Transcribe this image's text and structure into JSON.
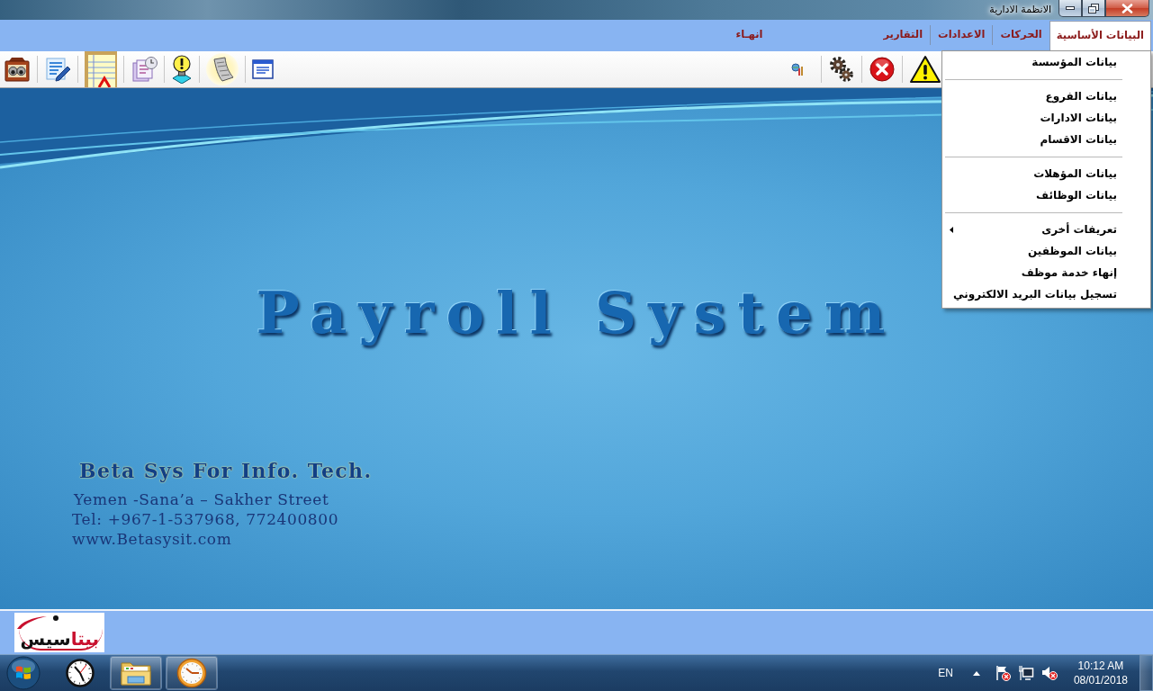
{
  "window": {
    "title": "الانظمة الادارية"
  },
  "menu_bar": {
    "items": [
      {
        "label": "البيانات الأساسية",
        "selected": true
      },
      {
        "label": "الحركات",
        "selected": false
      },
      {
        "label": "الاعدادات",
        "selected": false
      },
      {
        "label": "التقارير",
        "selected": false
      },
      {
        "label": "انهـاء",
        "selected": false
      }
    ]
  },
  "dropdown": {
    "groups": [
      {
        "items": [
          {
            "label": "بيانات المؤسسة",
            "submenu": false
          }
        ]
      },
      {
        "items": [
          {
            "label": "بيانات الفروع",
            "submenu": false
          },
          {
            "label": "بيانات الادارات",
            "submenu": false
          },
          {
            "label": "بيانات الاقسام",
            "submenu": false
          }
        ]
      },
      {
        "items": [
          {
            "label": "بيانات المؤهلات",
            "submenu": false
          },
          {
            "label": "بيانات الوظائف",
            "submenu": false
          }
        ]
      },
      {
        "items": [
          {
            "label": "تعريفات أخرى",
            "submenu": true
          },
          {
            "label": "بيانات الموظفين",
            "submenu": false
          },
          {
            "label": "إنهاء خدمة موظف",
            "submenu": false
          },
          {
            "label": "تسجيل بيانات البريد الالكتروني",
            "submenu": false
          }
        ]
      }
    ]
  },
  "splash": {
    "title": "Payroll System",
    "company": "Beta Sys For Info. Tech.",
    "address": "Yemen -Sana’a – Sakher Street",
    "phone": "Tel: +967-1-537968, 772400800",
    "website": "www.Betasysit.com"
  },
  "logo": {
    "parts": [
      {
        "text": "بيتا",
        "color": "#c8102e"
      },
      {
        "text": "سيس",
        "color": "#111111"
      }
    ]
  },
  "taskbar": {
    "apps": [
      {
        "kind": "clock",
        "running": false
      },
      {
        "kind": "folder",
        "running": true
      },
      {
        "kind": "alarm",
        "running": true
      }
    ],
    "tray": {
      "language": "EN",
      "time": "10:12 AM",
      "date": "08/01/2018"
    }
  }
}
